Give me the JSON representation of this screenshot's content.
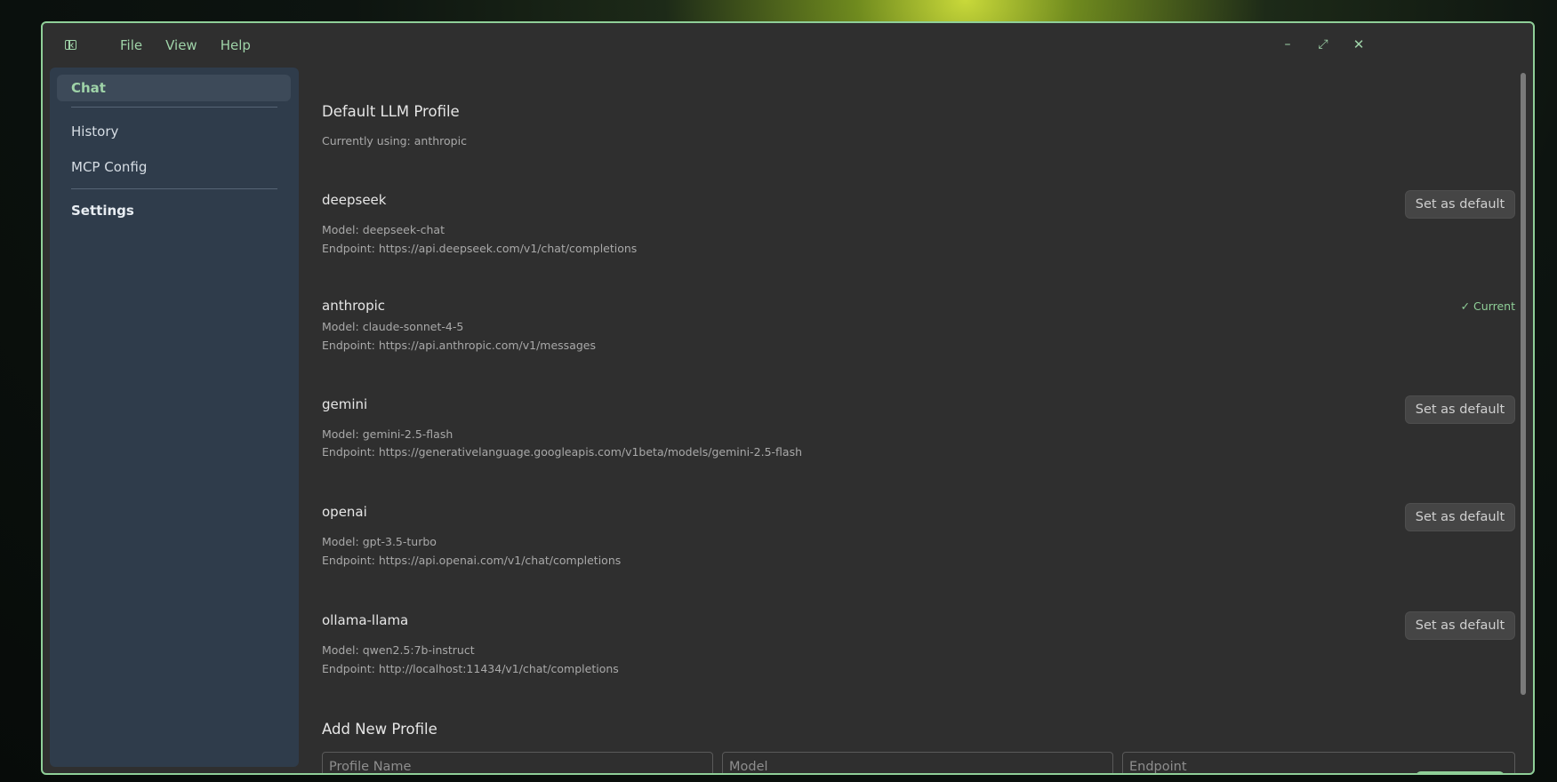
{
  "menu": [
    "File",
    "View",
    "Help"
  ],
  "window_controls": {
    "minimize": "minimize-icon",
    "maximize": "maximize-icon",
    "close": "close-icon"
  },
  "sidebar": {
    "items": [
      {
        "label": "Chat",
        "active": true
      },
      {
        "label": "History"
      },
      {
        "label": "MCP Config"
      },
      {
        "label": "Settings"
      }
    ]
  },
  "main": {
    "title": "Default LLM Profile",
    "currently_using": "Currently using: anthropic",
    "set_default_label": "Set as default",
    "current_label": "✓ Current",
    "profiles": [
      {
        "name": "deepseek",
        "model": "Model: deepseek-chat",
        "endpoint": "Endpoint: https://api.deepseek.com/v1/chat/completions"
      },
      {
        "name": "anthropic",
        "model": "Model: claude-sonnet-4-5",
        "endpoint": "Endpoint: https://api.anthropic.com/v1/messages"
      },
      {
        "name": "gemini",
        "model": "Model: gemini-2.5-flash",
        "endpoint": "Endpoint: https://generativelanguage.googleapis.com/v1beta/models/gemini-2.5-flash"
      },
      {
        "name": "openai",
        "model": "Model: gpt-3.5-turbo",
        "endpoint": "Endpoint: https://api.openai.com/v1/chat/completions"
      },
      {
        "name": "ollama-llama",
        "model": "Model: qwen2.5:7b-instruct",
        "endpoint": "Endpoint: http://localhost:11434/v1/chat/completions"
      }
    ],
    "add_profile": {
      "title": "Add New Profile",
      "name_placeholder": "Profile Name",
      "model_placeholder": "Model",
      "endpoint_placeholder": "Endpoint"
    }
  },
  "colors": {
    "accent": "#8fcf98",
    "sidebar_bg": "#2f3c4b",
    "window_bg": "#2f2f2f"
  }
}
